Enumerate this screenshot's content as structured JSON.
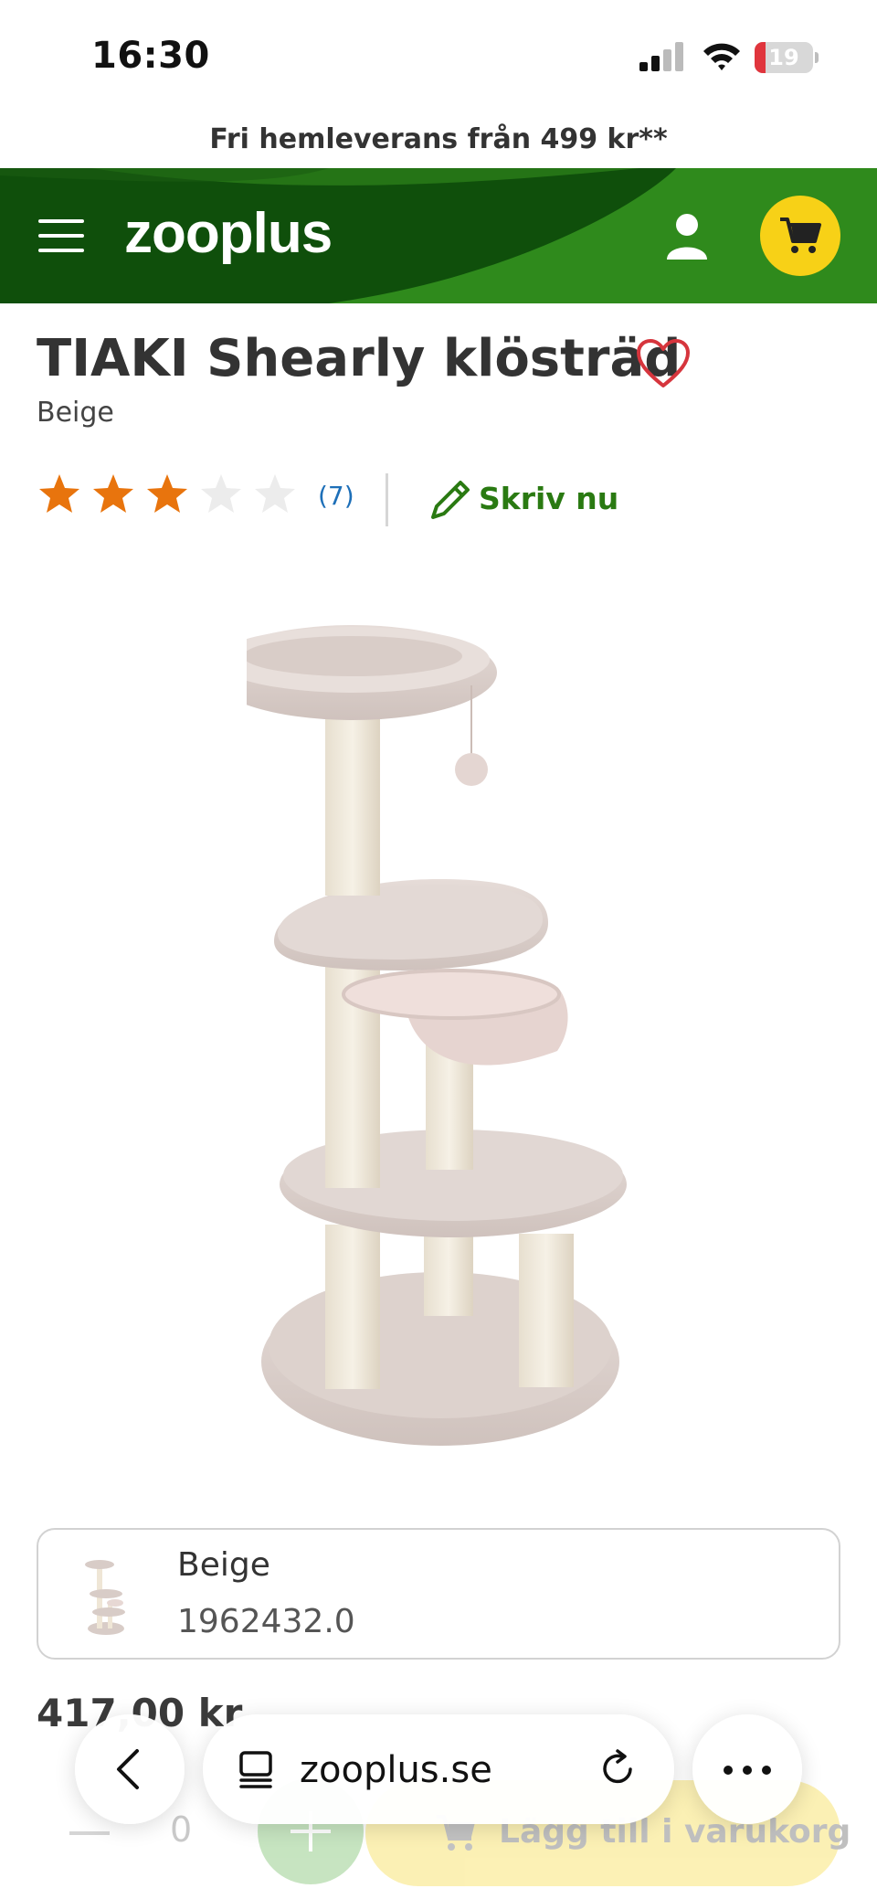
{
  "status_bar": {
    "time": "16:30",
    "battery": "19",
    "battery_level": 0.19
  },
  "promo": {
    "text": "Fri hemleverans från 499 kr**"
  },
  "header": {
    "logo": "zooplus",
    "menu_icon": "hamburger-menu-icon",
    "user_icon": "user-icon",
    "cart_icon": "shopping-cart-icon",
    "brand_green": "#0f4f0b",
    "cart_yellow": "#f7d117"
  },
  "product": {
    "title": "TIAKI Shearly klösträd",
    "variant_subtitle": "Beige",
    "rating": 3,
    "rating_max": 5,
    "review_count": "(7)",
    "write_review_label": "Skriv nu",
    "favorite_icon": "heart-outline-icon"
  },
  "carousel": {
    "prev_icon": "chevron-left-icon",
    "next_icon": "chevron-right-icon"
  },
  "variant_card": {
    "name": "Beige",
    "sku": "1962432.0"
  },
  "price": "417,00 kr",
  "cart_row": {
    "quantity": "0",
    "add_to_cart_label": "Lägg till i varukorg"
  },
  "browser": {
    "url": "zooplus.se",
    "back_icon": "back-chevron-icon",
    "tabs_icon": "tabs-icon",
    "reload_icon": "reload-icon",
    "more_icon": "more-dots-icon"
  }
}
